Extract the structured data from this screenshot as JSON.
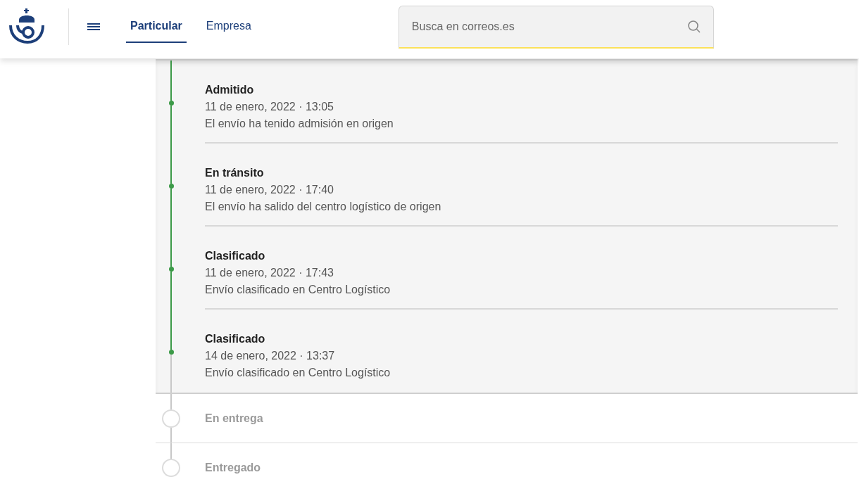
{
  "header": {
    "tabs": [
      {
        "label": "Particular",
        "selected": true
      },
      {
        "label": "Empresa",
        "selected": false
      }
    ],
    "search": {
      "placeholder": "Busca en correos.es"
    }
  },
  "steps": [
    {
      "title": "Admitido",
      "done": true,
      "date": "11 de enero, 2022 · 13:05",
      "description": "El envío ha tenido admisión en origen"
    },
    {
      "title": "En tránsito",
      "done": true,
      "date": "11 de enero, 2022 · 17:40",
      "description": "El envío ha salido del centro logístico de origen"
    },
    {
      "title": "Clasificado",
      "done": true,
      "date": "11 de enero, 2022 · 17:43",
      "description": "Envío clasificado en Centro Logístico"
    },
    {
      "title": "Clasificado",
      "done": true,
      "date": "14 de enero, 2022 · 13:37",
      "description": "Envío clasificado en Centro Logístico"
    },
    {
      "title": "En entrega",
      "done": false
    },
    {
      "title": "Entregado",
      "done": false
    }
  ]
}
